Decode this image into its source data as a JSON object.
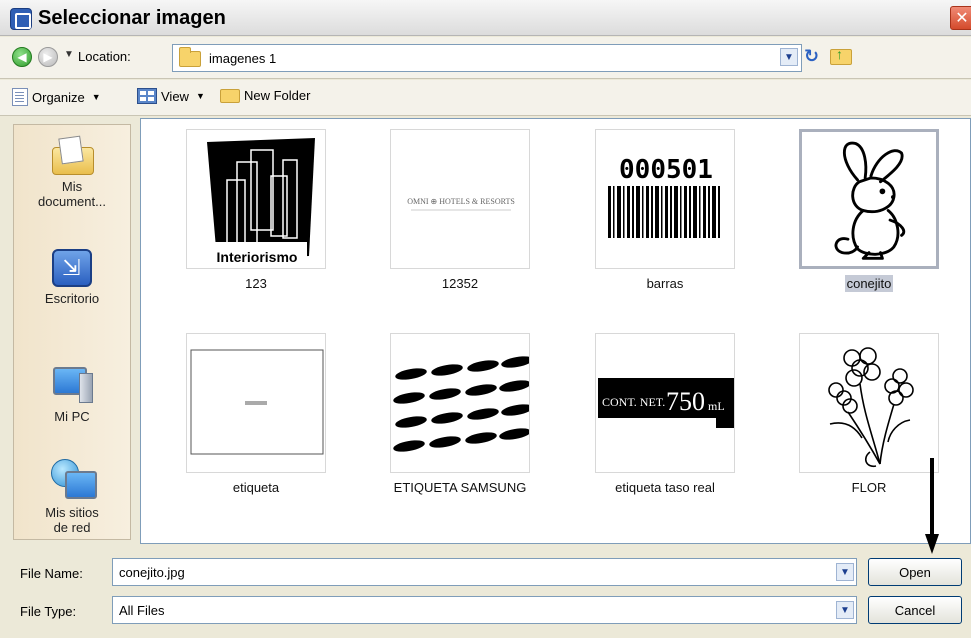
{
  "window": {
    "title": "Seleccionar imagen",
    "close_glyph": "✕"
  },
  "location": {
    "label": "Location:",
    "value": "imagenes 1"
  },
  "toolbar": {
    "organize_label": "Organize",
    "view_label": "View",
    "new_folder_label": "New Folder"
  },
  "places": [
    {
      "label_1": "Mis",
      "label_2": "document...",
      "icon": "my-documents-icon"
    },
    {
      "label_1": "Escritorio",
      "icon": "desktop-icon"
    },
    {
      "label_1": "Mi PC",
      "icon": "my-computer-icon"
    },
    {
      "label_1": "Mis sitios",
      "label_2": "de red",
      "icon": "network-places-icon"
    }
  ],
  "files": [
    {
      "name": "123",
      "thumb_text": "Interiorismo"
    },
    {
      "name": "12352",
      "thumb_text": "OMNI ⊕ HOTELS & RESORTS"
    },
    {
      "name": "barras",
      "thumb_text": "000501"
    },
    {
      "name": "conejito",
      "selected": true
    },
    {
      "name": "etiqueta"
    },
    {
      "name": "ETIQUETA SAMSUNG"
    },
    {
      "name": "etiqueta taso real",
      "thumb_text_small": "CONT. NET.",
      "thumb_text_big": "750",
      "thumb_text_unit": "mL"
    },
    {
      "name": "FLOR"
    }
  ],
  "file_name": {
    "label": "File Name:",
    "value": "conejito.jpg"
  },
  "file_type": {
    "label": "File Type:",
    "value": "All Files"
  },
  "buttons": {
    "open": "Open",
    "cancel": "Cancel"
  },
  "colors": {
    "selection": "#c5cad6",
    "window_bg": "#ece9d8",
    "field_border": "#7f9db9"
  }
}
